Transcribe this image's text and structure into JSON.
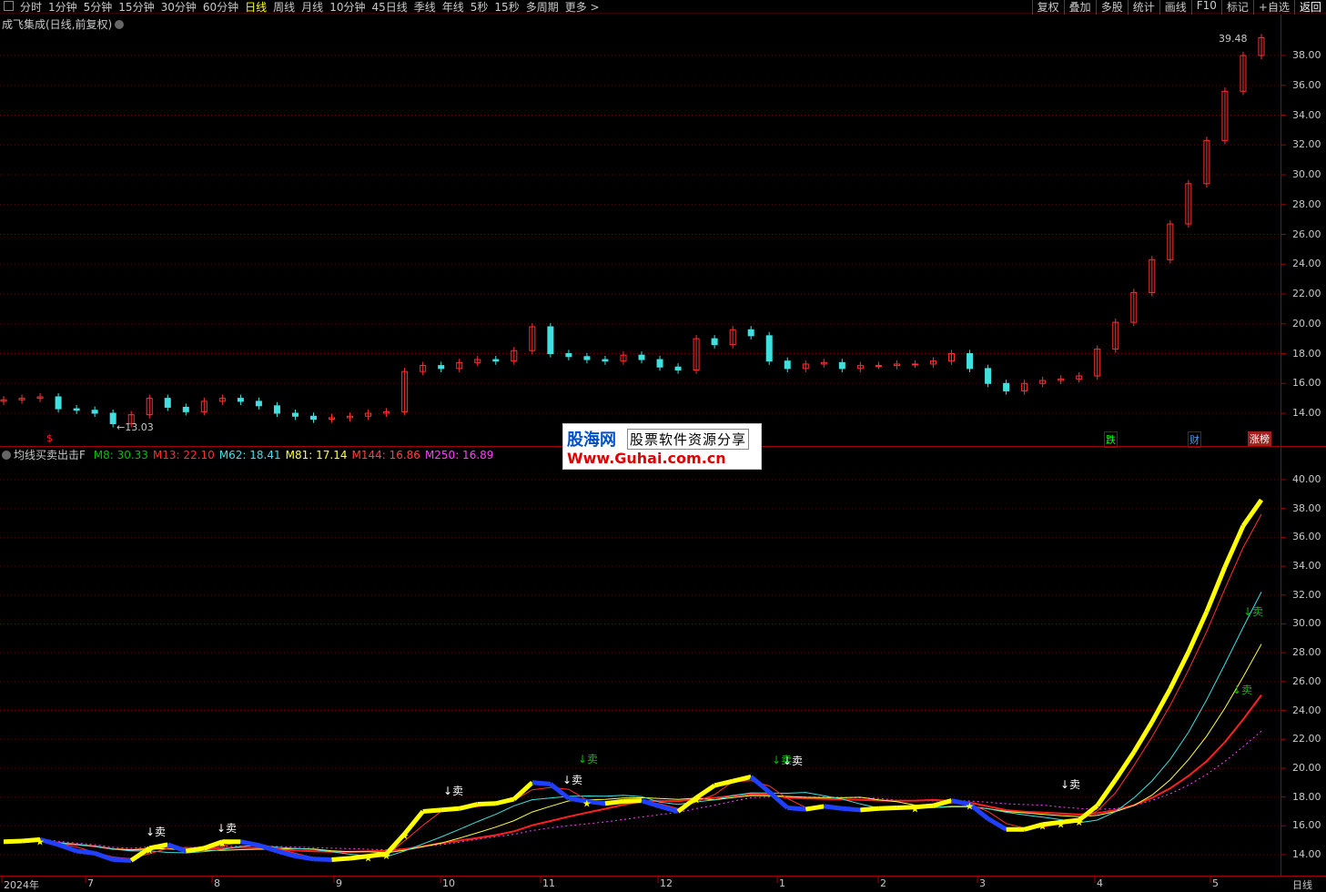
{
  "toolbar": {
    "periods": [
      "分时",
      "1分钟",
      "5分钟",
      "15分钟",
      "30分钟",
      "60分钟",
      "日线",
      "周线",
      "月线",
      "10分钟",
      "45日线",
      "季线",
      "年线",
      "5秒",
      "15秒",
      "多周期",
      "更多 >"
    ],
    "active": "日线",
    "right_buttons": [
      "复权",
      "叠加",
      "多股",
      "统计",
      "画线",
      "F10",
      "标记",
      "+自选",
      "返回"
    ]
  },
  "main_title": "成飞集成(日线,前复权)",
  "indicator": {
    "name": "均线买卖出击F",
    "lines": [
      {
        "label": "M8:",
        "value": "30.33",
        "color": "#00c000"
      },
      {
        "label": "M13:",
        "value": "22.10",
        "color": "#ff3030"
      },
      {
        "label": "M62:",
        "value": "18.41",
        "color": "#40e0e0"
      },
      {
        "label": "M81:",
        "value": "17.14",
        "color": "#ffff40"
      },
      {
        "label": "M144:",
        "value": "16.86",
        "color": "#ff4040"
      },
      {
        "label": "M250:",
        "value": "16.89",
        "color": "#ff40ff"
      }
    ]
  },
  "price_axis": [
    "38.00",
    "36.00",
    "34.00",
    "32.00",
    "30.00",
    "28.00",
    "26.00",
    "24.00",
    "22.00",
    "20.00",
    "18.00",
    "16.00",
    "14.00"
  ],
  "indicator_axis": [
    "40.00",
    "38.00",
    "36.00",
    "34.00",
    "32.00",
    "30.00",
    "28.00",
    "26.00",
    "24.00",
    "22.00",
    "20.00",
    "18.00",
    "16.00",
    "14.00"
  ],
  "high_label": "39.48",
  "low_label": "←13.03",
  "x_labels": [
    "2024年",
    "7",
    "8",
    "9",
    "10",
    "11",
    "12",
    "1",
    "2",
    "3",
    "4",
    "5"
  ],
  "x_corner": "日线",
  "markers": {
    "s_marker": "$",
    "die": "跌",
    "cai": "财",
    "zhangbang": "涨榜"
  },
  "sell_label": "↓卖",
  "star": "★",
  "watermark": {
    "logo": "股海网",
    "slogan": "股票软件资源分享",
    "url": "Www.Guhai.com.cn"
  },
  "chart_data": {
    "type": "candlestick",
    "title": "成飞集成(日线,前复权)",
    "ylim": [
      13,
      40
    ],
    "high": 39.48,
    "low": 13.03,
    "closes_sampled": [
      14.9,
      15.0,
      15.1,
      14.3,
      14.2,
      14.0,
      13.3,
      13.9,
      15.0,
      14.4,
      14.1,
      14.8,
      15.0,
      14.8,
      14.5,
      14.0,
      13.8,
      13.6,
      13.7,
      13.8,
      14.0,
      14.1,
      16.8,
      17.2,
      17.0,
      17.4,
      17.6,
      17.5,
      18.2,
      19.8,
      18.0,
      17.8,
      17.6,
      17.5,
      17.9,
      17.6,
      17.1,
      16.9,
      19.0,
      18.6,
      19.6,
      19.2,
      17.5,
      17.0,
      17.3,
      17.4,
      17.0,
      17.2,
      17.2,
      17.3,
      17.3,
      17.5,
      18.0,
      17.0,
      16.0,
      15.5,
      16.0,
      16.2,
      16.3,
      16.5,
      18.3,
      20.1,
      22.1,
      24.3,
      26.7,
      29.4,
      32.3,
      35.6,
      38.0,
      39.2
    ],
    "ma_series": [
      "M8",
      "M13",
      "M62",
      "M81",
      "M144",
      "M250"
    ]
  }
}
